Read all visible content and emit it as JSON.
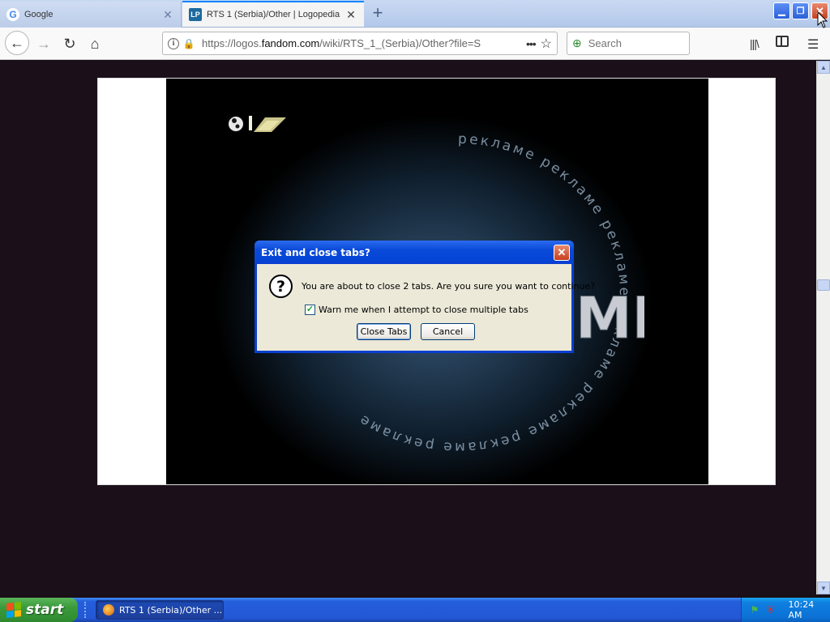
{
  "browser": {
    "tabs": [
      {
        "title": "Google",
        "favicon": "google-g-icon",
        "active": false
      },
      {
        "title": "RTS 1 (Serbia)/Other | Logopedia",
        "favicon": "logopedia-lp-icon",
        "favicon_text": "LP",
        "active": true
      }
    ],
    "favicon_google_text": "G",
    "url_prefix": "https://logos.",
    "url_host": "fandom.com",
    "url_suffix": "/wiki/RTS_1_(Serbia)/Other?file=S",
    "search_placeholder": "Search",
    "accent_color": "#0a84ff"
  },
  "dialog": {
    "title": "Exit and close tabs?",
    "message": "You are about to close 2 tabs. Are you sure you want to continue?",
    "checkbox_label": "Warn me when I attempt to close multiple tabs",
    "checkbox_checked": true,
    "primary_button": "Close Tabs",
    "secondary_button": "Cancel",
    "icon": "question-icon"
  },
  "taskbar": {
    "start_label": "start",
    "task_title": "RTS 1 (Serbia)/Other ...",
    "clock": "10:24 AM",
    "colors": {
      "start_green": "#3a9a3a",
      "bar_blue": "#245edb"
    }
  }
}
